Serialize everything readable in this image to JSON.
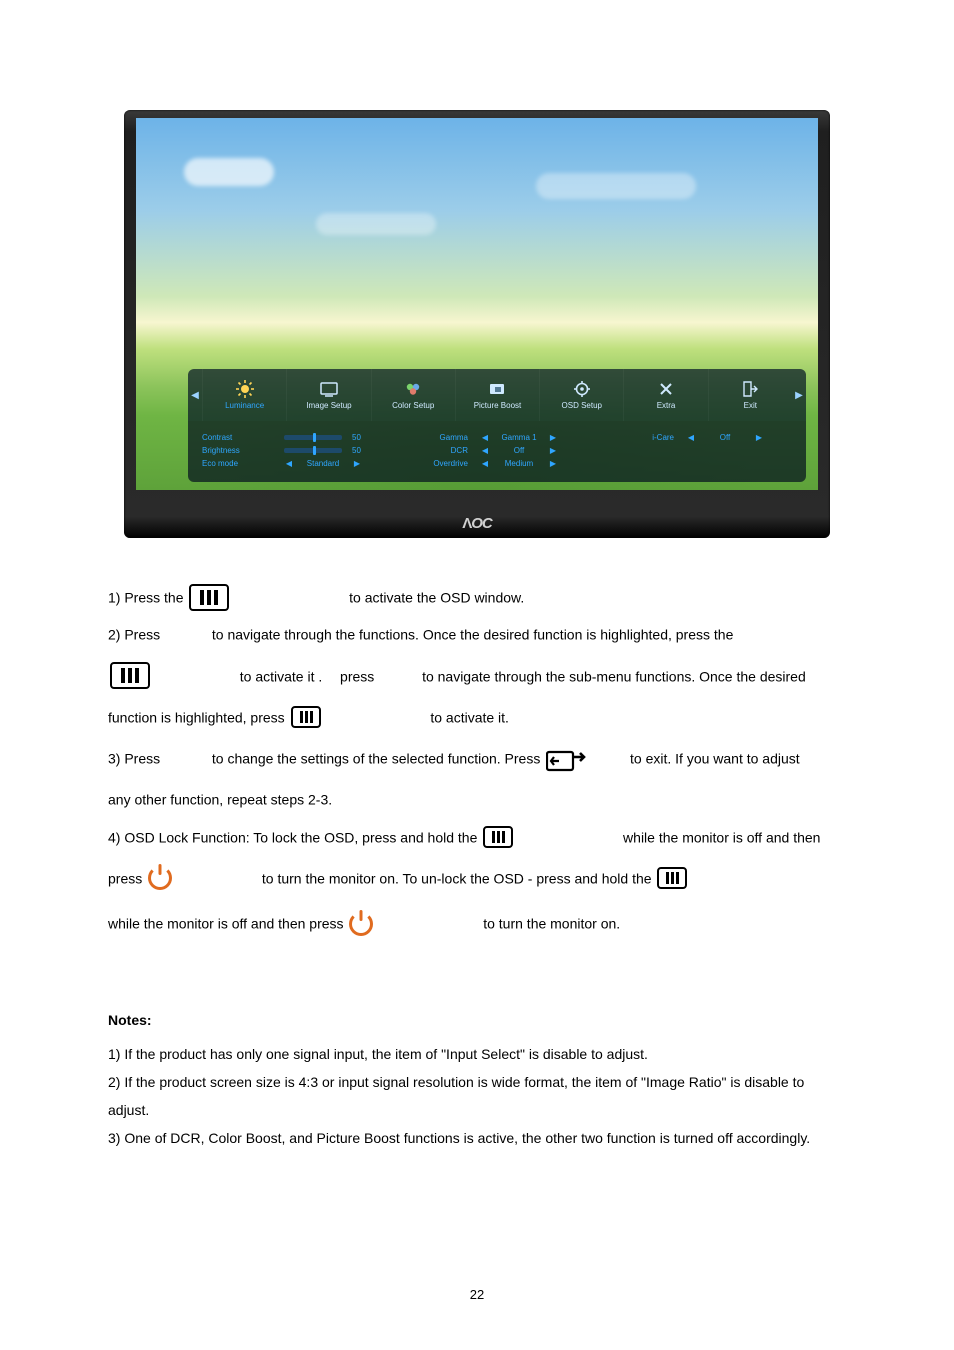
{
  "osd": {
    "tabs": [
      {
        "label": "Luminance",
        "icon": "sun-icon"
      },
      {
        "label": "Image Setup",
        "icon": "image-setup-icon"
      },
      {
        "label": "Color Setup",
        "icon": "color-setup-icon"
      },
      {
        "label": "Picture Boost",
        "icon": "picture-boost-icon"
      },
      {
        "label": "OSD Setup",
        "icon": "osd-setup-icon"
      },
      {
        "label": "Extra",
        "icon": "extra-icon"
      },
      {
        "label": "Exit",
        "icon": "exit-icon"
      }
    ],
    "left_col": {
      "contrast": {
        "label": "Contrast",
        "value": "50",
        "fill_pct": 50
      },
      "brightness": {
        "label": "Brightness",
        "value": "50",
        "fill_pct": 50
      },
      "eco": {
        "label": "Eco mode",
        "value": "Standard"
      }
    },
    "mid_col": {
      "gamma": {
        "label": "Gamma",
        "value": "Gamma 1"
      },
      "dcr": {
        "label": "DCR",
        "value": "Off"
      },
      "overdrive": {
        "label": "Overdrive",
        "value": "Medium"
      }
    },
    "right_col": {
      "icare": {
        "label": "i-Care",
        "value": "Off"
      }
    },
    "logo": "AOC"
  },
  "instructions": {
    "s1a": "1) Press the ",
    "s1b": " to activate the OSD window.",
    "s2a": "2) Press ",
    "s2b": " to navigate through the functions. Once the desired function is highlighted, press the",
    "s2c": "to activate it . ",
    "s2c2": "press",
    "s2d": " to navigate through the sub-menu functions. Once the desired",
    "s2e": "function is highlighted, press ",
    "s2f": " to activate it.",
    "s3a": "3) Press ",
    "s3b": " to change the settings of the selected function. Press ",
    "s3c": " to exit.   If you want to adjust",
    "s3d": "any other function, repeat steps 2-3.",
    "s4a": "4) OSD Lock Function: To lock the OSD, press and hold the ",
    "s4b": " while the monitor is off and then",
    "s4c": "press",
    "s4d": " to turn the monitor on. To un-lock the OSD - press and hold the ",
    "s4e": "while the monitor is off and then press ",
    "s4f": " to turn the monitor on."
  },
  "notes": {
    "title": "Notes:",
    "n1": "1) If the product has only one signal input, the item of \"Input Select\" is disable to adjust.",
    "n2": "2) If the product screen size is 4:3 or input signal resolution is wide format, the item of \"Image Ratio\" is disable to adjust.",
    "n3": "3) One of DCR, Color Boost, and Picture Boost functions is active, the other two function is turned off accordingly."
  },
  "page_number": "22"
}
